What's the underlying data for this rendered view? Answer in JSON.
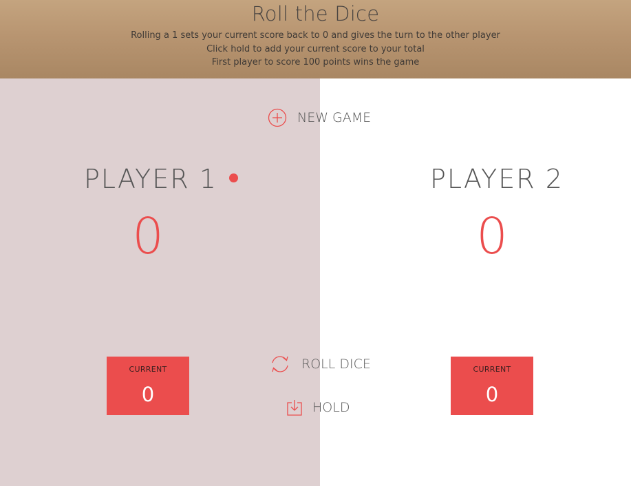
{
  "header": {
    "title": "Roll the Dice",
    "rules": [
      "Rolling a 1 sets your current score back to 0 and gives the turn to the other player",
      "Click hold to add your current score to your total",
      "First player to score 100 points wins the game"
    ]
  },
  "controls": {
    "new_game_label": "NEW GAME",
    "roll_label": "ROLL DICE",
    "hold_label": "HOLD",
    "new_game_icon": "plus-circle-icon",
    "roll_icon": "refresh-icon",
    "hold_icon": "download-icon"
  },
  "players": [
    {
      "name": "PLAYER 1",
      "score": "0",
      "current_label": "CURRENT",
      "current_score": "0",
      "active": true
    },
    {
      "name": "PLAYER 2",
      "score": "0",
      "current_label": "CURRENT",
      "current_score": "0",
      "active": false
    }
  ],
  "colors": {
    "accent": "#eb4d4d",
    "active_panel": "#ded0d1",
    "inactive_panel": "#ffffff",
    "text": "#555555"
  }
}
